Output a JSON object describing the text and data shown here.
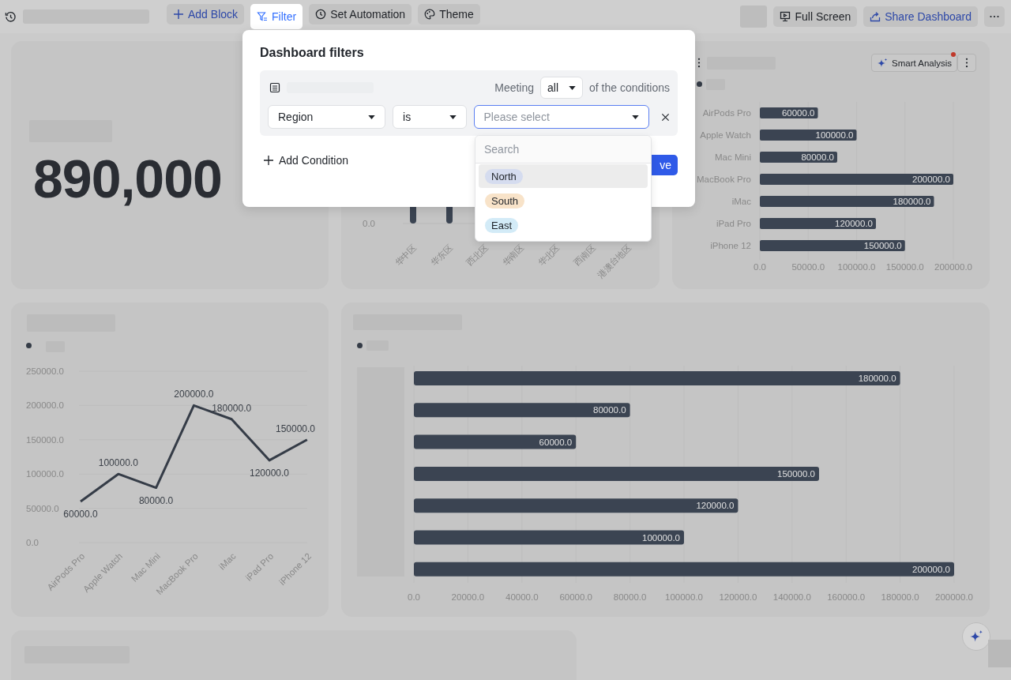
{
  "toolbar": {
    "buttons": [
      {
        "kind": "add",
        "label": "Add Block",
        "selected": false
      },
      {
        "kind": "filter",
        "label": "Filter",
        "selected": true
      },
      {
        "kind": "automation",
        "label": "Set Automation",
        "selected": false
      },
      {
        "kind": "theme",
        "label": "Theme",
        "selected": false
      }
    ],
    "right_buttons": [
      {
        "kind": "fullscreen",
        "label": "Full Screen"
      },
      {
        "kind": "share",
        "label": "Share Dashboard"
      }
    ]
  },
  "filter_dialog": {
    "title": "Dashboard filters",
    "meeting_label": "Meeting",
    "match": "all",
    "match_suffix": "of the conditions",
    "condition": {
      "field": "Region",
      "operator": "is",
      "value_placeholder": "Please select",
      "open": true
    },
    "add_condition": "Add Condition",
    "save_button": "ve",
    "dropdown": {
      "search_placeholder": "Search",
      "options": [
        {
          "label": "North",
          "color": "#d5dcef",
          "selected": true
        },
        {
          "label": "South",
          "color": "#f8e3c9",
          "selected": false
        },
        {
          "label": "East",
          "color": "#d3ebf7",
          "selected": false
        }
      ]
    }
  },
  "kpi": {
    "value": "890,000"
  },
  "region_chart": {
    "y_tick": "0.0",
    "x_labels": [
      "华中区",
      "华东区",
      "西北区",
      "华南区",
      "华北区",
      "西南区",
      "港澳台地区"
    ]
  },
  "product_bar_chart": {
    "smart_analysis": "Smart Analysis",
    "has_notification": true,
    "chart_data": {
      "type": "bar",
      "orientation": "horizontal",
      "categories": [
        "AirPods Pro",
        "Apple Watch",
        "Mac Mini",
        "MacBook Pro",
        "iMac",
        "iPad Pro",
        "iPhone 12"
      ],
      "values": [
        60000,
        100000,
        80000,
        200000,
        180000,
        120000,
        150000
      ],
      "xlim": [
        0,
        200000
      ],
      "xticks": [
        {
          "value": 0,
          "label": "0.0"
        },
        {
          "value": 50000,
          "label": "50000.0"
        },
        {
          "value": 100000,
          "label": "100000.0"
        },
        {
          "value": 150000,
          "label": "150000.0"
        },
        {
          "value": 200000,
          "label": "200000.0"
        }
      ],
      "grid": true,
      "value_labels": [
        "60000.0",
        "100000.0",
        "80000.0",
        "200000.0",
        "180000.0",
        "120000.0",
        "150000.0"
      ]
    }
  },
  "line_chart": {
    "chart_data": {
      "type": "line",
      "categories": [
        "AirPods Pro",
        "Apple Watch",
        "Mac Mini",
        "MacBook Pro",
        "iMac",
        "iPad Pro",
        "iPhone 12"
      ],
      "series": [
        {
          "color": "#353c47",
          "values": [
            60000,
            100000,
            80000,
            200000,
            180000,
            120000,
            150000
          ]
        }
      ],
      "ylim": [
        0,
        250000
      ],
      "yticks": [
        {
          "value": 0,
          "label": "0.0"
        },
        {
          "value": 50000,
          "label": "50000.0"
        },
        {
          "value": 100000,
          "label": "100000.0"
        },
        {
          "value": 150000,
          "label": "150000.0"
        },
        {
          "value": 200000,
          "label": "200000.0"
        },
        {
          "value": 250000,
          "label": "250000.0"
        }
      ],
      "grid": true,
      "value_labels": [
        "60000.0",
        "100000.0",
        "80000.0",
        "200000.0",
        "180000.0",
        "120000.0",
        "150000.0"
      ]
    }
  },
  "bar_chart_2": {
    "chart_data": {
      "type": "bar",
      "orientation": "horizontal",
      "values": [
        180000,
        80000,
        60000,
        150000,
        120000,
        100000,
        200000
      ],
      "xlim": [
        0,
        200000
      ],
      "xticks": [
        {
          "value": 0,
          "label": "0.0"
        },
        {
          "value": 20000,
          "label": "20000.0"
        },
        {
          "value": 40000,
          "label": "40000.0"
        },
        {
          "value": 60000,
          "label": "60000.0"
        },
        {
          "value": 80000,
          "label": "80000.0"
        },
        {
          "value": 100000,
          "label": "100000.0"
        },
        {
          "value": 120000,
          "label": "120000.0"
        },
        {
          "value": 140000,
          "label": "140000.0"
        },
        {
          "value": 160000,
          "label": "160000.0"
        },
        {
          "value": 180000,
          "label": "180000.0"
        },
        {
          "value": 200000,
          "label": "200000.0"
        }
      ],
      "grid": true,
      "value_labels": [
        "180000.0",
        "80000.0",
        "60000.0",
        "150000.0",
        "120000.0",
        "100000.0",
        "200000.0"
      ]
    }
  }
}
